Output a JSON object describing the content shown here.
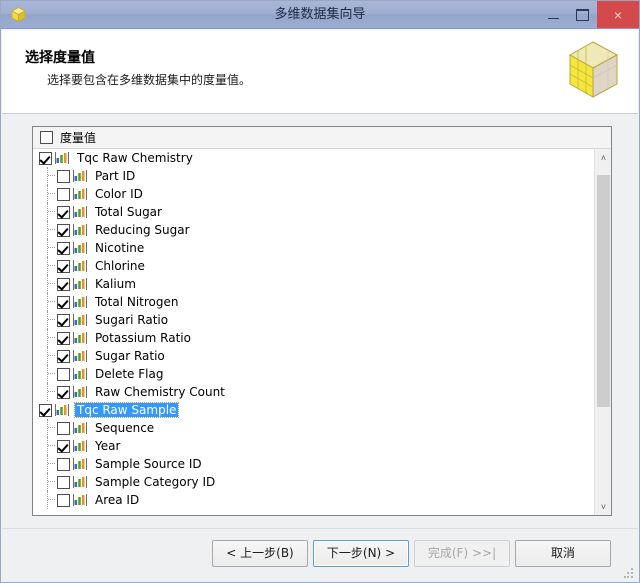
{
  "window": {
    "title": "多维数据集向导",
    "icon": "cube-icon",
    "minimize_label": "最小化",
    "maximize_label": "最大化",
    "close_label": "×"
  },
  "banner": {
    "title": "选择度量值",
    "subtitle": "选择要包含在多维数据集中的度量值。",
    "icon": "cube-icon"
  },
  "group": {
    "header_label": "度量值",
    "header_checked": false
  },
  "tree": {
    "items": [
      {
        "label": "Tqc Raw Chemistry",
        "checked": true,
        "level": 0,
        "selected": false
      },
      {
        "label": "Part ID",
        "checked": false,
        "level": 1,
        "selected": false
      },
      {
        "label": "Color ID",
        "checked": false,
        "level": 1,
        "selected": false
      },
      {
        "label": "Total Sugar",
        "checked": true,
        "level": 1,
        "selected": false
      },
      {
        "label": "Reducing Sugar",
        "checked": true,
        "level": 1,
        "selected": false
      },
      {
        "label": "Nicotine",
        "checked": true,
        "level": 1,
        "selected": false
      },
      {
        "label": "Chlorine",
        "checked": true,
        "level": 1,
        "selected": false
      },
      {
        "label": "Kalium",
        "checked": true,
        "level": 1,
        "selected": false
      },
      {
        "label": "Total Nitrogen",
        "checked": true,
        "level": 1,
        "selected": false
      },
      {
        "label": "Sugari Ratio",
        "checked": true,
        "level": 1,
        "selected": false
      },
      {
        "label": "Potassium Ratio",
        "checked": true,
        "level": 1,
        "selected": false
      },
      {
        "label": "Sugar Ratio",
        "checked": true,
        "level": 1,
        "selected": false
      },
      {
        "label": "Delete Flag",
        "checked": false,
        "level": 1,
        "selected": false
      },
      {
        "label": "Raw Chemistry Count",
        "checked": true,
        "level": 1,
        "selected": false
      },
      {
        "label": "Tqc Raw Sample",
        "checked": true,
        "level": 0,
        "selected": true
      },
      {
        "label": "Sequence",
        "checked": false,
        "level": 1,
        "selected": false
      },
      {
        "label": "Year",
        "checked": true,
        "level": 1,
        "selected": false
      },
      {
        "label": "Sample Source ID",
        "checked": false,
        "level": 1,
        "selected": false
      },
      {
        "label": "Sample Category ID",
        "checked": false,
        "level": 1,
        "selected": false
      },
      {
        "label": "Area ID",
        "checked": false,
        "level": 1,
        "selected": false
      }
    ]
  },
  "scrollbar": {
    "up_arrow": "˄",
    "down_arrow": "˅"
  },
  "footer": {
    "back_label": "< 上一步(B)",
    "next_label": "下一步(N) >",
    "finish_label": "完成(F) >>|",
    "finish_disabled": true,
    "cancel_label": "取消"
  },
  "colors": {
    "titlebar": "#9fafd2",
    "close_button": "#d44a4a",
    "selection": "#3399ff",
    "accent_border": "#5a9fd4",
    "cube_yellow": "#f2e33a"
  }
}
